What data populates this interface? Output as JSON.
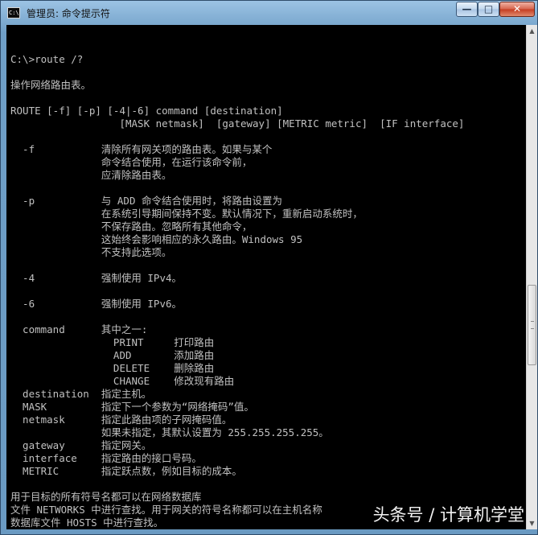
{
  "window": {
    "icon_text": "C:\\",
    "title": "管理员: 命令提示符",
    "controls": {
      "minimize": "—",
      "maximize": "□",
      "close": "✕"
    }
  },
  "console": {
    "lines": [
      "",
      "C:\\>route /?",
      "",
      "操作网络路由表。",
      "",
      "ROUTE [-f] [-p] [-4|-6] command [destination]",
      "                  [MASK netmask]  [gateway] [METRIC metric]  [IF interface]",
      "",
      "  -f           清除所有网关项的路由表。如果与某个",
      "               命令结合使用，在运行该命令前，",
      "               应清除路由表。",
      "",
      "  -p           与 ADD 命令结合使用时，将路由设置为",
      "               在系统引导期间保持不变。默认情况下，重新启动系统时，",
      "               不保存路由。忽略所有其他命令，",
      "               这始终会影响相应的永久路由。Windows 95",
      "               不支持此选项。",
      "",
      "  -4           强制使用 IPv4。",
      "",
      "  -6           强制使用 IPv6。",
      "",
      "  command      其中之一:",
      "                 PRINT     打印路由",
      "                 ADD       添加路由",
      "                 DELETE    删除路由",
      "                 CHANGE    修改现有路由",
      "  destination  指定主机。",
      "  MASK         指定下一个参数为“网络掩码”值。",
      "  netmask      指定此路由项的子网掩码值。",
      "               如果未指定，其默认设置为 255.255.255.255。",
      "  gateway      指定网关。",
      "  interface    指定路由的接口号码。",
      "  METRIC       指定跃点数，例如目标的成本。",
      "",
      "用于目标的所有符号名都可以在网络数据库",
      "文件 NETWORKS 中进行查找。用于网关的符号名称都可以在主机名称",
      "数据库文件 HOSTS 中进行查找。"
    ]
  },
  "scrollbar": {
    "up": "▲",
    "down": "▼",
    "position": 0.62
  },
  "watermark": "头条号 / 计算机学堂"
}
